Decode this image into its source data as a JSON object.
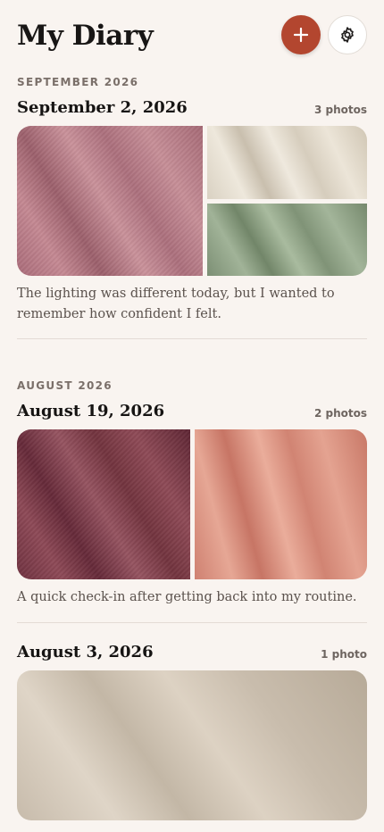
{
  "header": {
    "title": "My Diary",
    "add_icon": "plus-icon",
    "settings_icon": "gear-icon",
    "accent_color": "#b3462f"
  },
  "sections": [
    {
      "month": "SEPTEMBER 2026",
      "entries": [
        {
          "date": "September 2, 2026",
          "photo_count": "3 photos",
          "caption": "The lighting was different today, but I wanted to remember how confident I felt."
        }
      ]
    },
    {
      "month": "AUGUST 2026",
      "entries": [
        {
          "date": "August 19, 2026",
          "photo_count": "2 photos",
          "caption": "A quick check-in after getting back into my routine."
        },
        {
          "date": "August 3, 2026",
          "photo_count": "1 photo",
          "caption": ""
        }
      ]
    }
  ]
}
